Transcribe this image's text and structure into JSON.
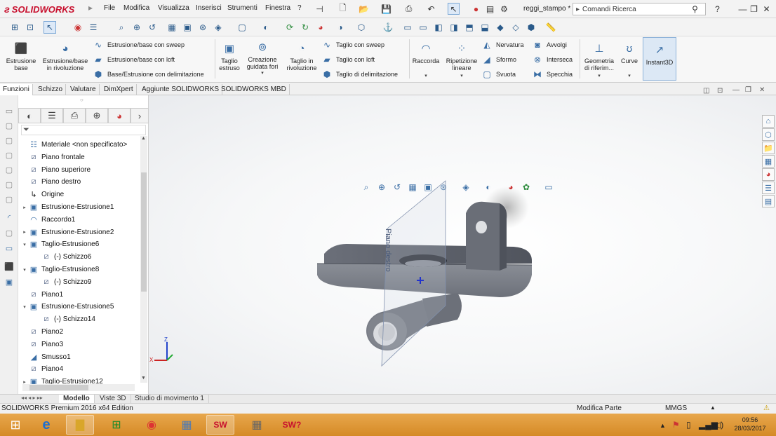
{
  "app": {
    "logo_text": "SOLIDWORKS",
    "doc_title": "reggi_stampo *",
    "search_placeholder": "Comandi Ricerca"
  },
  "menu": [
    "File",
    "Modifica",
    "Visualizza",
    "Inserisci",
    "Strumenti",
    "Finestra",
    "?"
  ],
  "ribbon": {
    "extrude_boss": "Estrusione base",
    "revolve_boss": "Estrusione/base in rivoluzione",
    "swept_boss": "Estrusione/base con sweep",
    "lofted_boss": "Estrusione/base con loft",
    "boundary_boss": "Base/Estrusione con delimitazione",
    "extruded_cut": "Taglio estruso",
    "hole_wizard": "Creazione guidata fori",
    "revolved_cut": "Taglio in rivoluzione",
    "swept_cut": "Taglio con sweep",
    "lofted_cut": "Taglio con loft",
    "boundary_cut": "Taglio di delimitazione",
    "fillet": "Raccorda",
    "linear_pattern": "Ripetizione lineare",
    "rib": "Nervatura",
    "draft": "Sformo",
    "shell": "Svuota",
    "wrap": "Avvolgi",
    "intersect": "Interseca",
    "mirror": "Specchia",
    "ref_geometry": "Geometria di riferim...",
    "curves": "Curve",
    "instant3d": "Instant3D"
  },
  "tabs": [
    "Funzioni",
    "Schizzo",
    "Valutare",
    "DimXpert",
    "Aggiunte SOLIDWORKS",
    "SOLIDWORKS MBD"
  ],
  "tree": {
    "items": [
      {
        "label": "Materiale <non specificato>",
        "expand": "",
        "icon": "material",
        "indent": 0
      },
      {
        "label": "Piano frontale",
        "expand": "",
        "icon": "plane",
        "indent": 0
      },
      {
        "label": "Piano superiore",
        "expand": "",
        "icon": "plane",
        "indent": 0
      },
      {
        "label": "Piano destro",
        "expand": "",
        "icon": "plane",
        "indent": 0
      },
      {
        "label": "Origine",
        "expand": "",
        "icon": "origin",
        "indent": 0
      },
      {
        "label": "Estrusione-Estrusione1",
        "expand": "▸",
        "icon": "extrude",
        "indent": 0
      },
      {
        "label": "Raccordo1",
        "expand": "",
        "icon": "fillet",
        "indent": 0
      },
      {
        "label": "Estrusione-Estrusione2",
        "expand": "▸",
        "icon": "extrude",
        "indent": 0
      },
      {
        "label": "Taglio-Estrusione6",
        "expand": "▾",
        "icon": "cut",
        "indent": 0
      },
      {
        "label": "(-) Schizzo6",
        "expand": "",
        "icon": "sketch",
        "indent": 1
      },
      {
        "label": "Taglio-Estrusione8",
        "expand": "▾",
        "icon": "cut",
        "indent": 0
      },
      {
        "label": "(-) Schizzo9",
        "expand": "",
        "icon": "sketch",
        "indent": 1
      },
      {
        "label": "Piano1",
        "expand": "",
        "icon": "plane",
        "indent": 0
      },
      {
        "label": "Estrusione-Estrusione5",
        "expand": "▾",
        "icon": "extrude",
        "indent": 0
      },
      {
        "label": "(-) Schizzo14",
        "expand": "",
        "icon": "sketch",
        "indent": 1
      },
      {
        "label": "Piano2",
        "expand": "",
        "icon": "plane",
        "indent": 0
      },
      {
        "label": "Piano3",
        "expand": "",
        "icon": "plane",
        "indent": 0
      },
      {
        "label": "Smusso1",
        "expand": "",
        "icon": "chamfer",
        "indent": 0
      },
      {
        "label": "Piano4",
        "expand": "",
        "icon": "plane",
        "indent": 0
      },
      {
        "label": "Taglio-Estrusione12",
        "expand": "▸",
        "icon": "cut",
        "indent": 0
      }
    ]
  },
  "viewport": {
    "plane_label": "Piano destro"
  },
  "bottom_tabs": [
    "Modello",
    "Viste 3D",
    "Studio di movimento 1"
  ],
  "status": {
    "edition": "SOLIDWORKS Premium 2016 x64 Edition",
    "mode": "Modifica Parte",
    "units": "MMGS"
  },
  "taskbar": {
    "time": "09:56",
    "date": "28/03/2017"
  }
}
